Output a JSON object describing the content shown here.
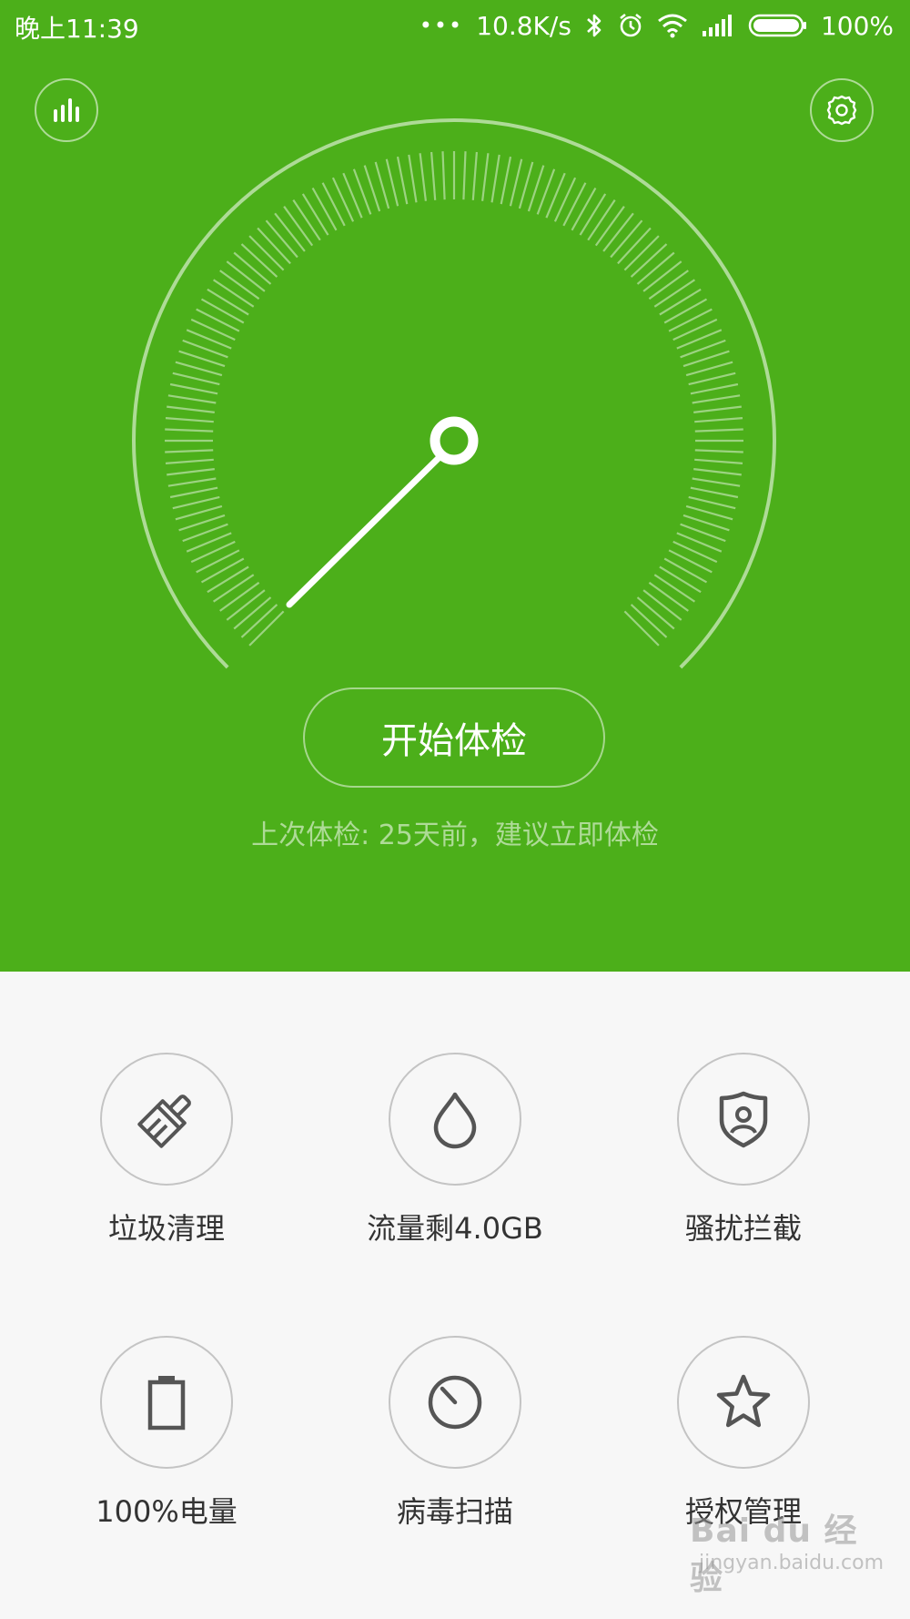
{
  "status_bar": {
    "time": "晚上11:39",
    "dots": "•••",
    "speed": "10.8K/s",
    "battery": "100%",
    "icons": [
      "bluetooth-icon",
      "alarm-icon",
      "wifi-icon",
      "signal-icon",
      "battery-icon"
    ]
  },
  "header": {
    "left_icon": "bar-chart-icon",
    "right_icon": "gear-icon"
  },
  "gauge": {
    "needle_icon": "gauge-needle"
  },
  "main": {
    "start_button": "开始体检",
    "last_check": "上次体检: 25天前，建议立即体检"
  },
  "features": [
    {
      "label": "垃圾清理",
      "icon": "broom-icon"
    },
    {
      "label": "流量剩4.0GB",
      "icon": "water-drop-icon"
    },
    {
      "label": "骚扰拦截",
      "icon": "shield-user-icon"
    },
    {
      "label": "100%电量",
      "icon": "battery-icon"
    },
    {
      "label": "病毒扫描",
      "icon": "scan-dial-icon"
    },
    {
      "label": "授权管理",
      "icon": "star-icon"
    }
  ],
  "watermark": {
    "main": "Bai du 经验",
    "sub": "jingyan.baidu.com"
  },
  "colors": {
    "primary_green": "#4caf1a",
    "background": "#f7f7f7",
    "icon_gray": "#555555"
  }
}
